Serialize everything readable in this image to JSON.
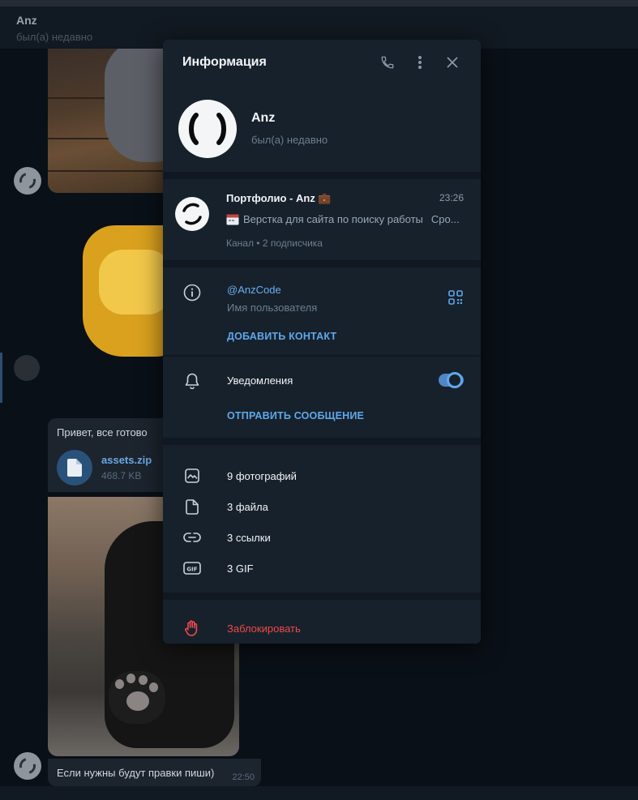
{
  "chat": {
    "title": "Anz",
    "status": "был(а) недавно",
    "messages": {
      "greeting": "Привет, все готово",
      "file_name": "assets.zip",
      "file_size": "468.7 KB",
      "last_text": "Если нужны будут правки пиши)",
      "last_time": "22:50"
    }
  },
  "info_panel": {
    "title": "Информация",
    "profile": {
      "name": "Anz",
      "status": "был(а) недавно"
    },
    "channel": {
      "name": "Портфолио - Anz 💼",
      "time": "23:26",
      "preview": "Верстка для сайта по поиску работы",
      "preview_tail": "Сро...",
      "subscribers": "Канал • 2 подписчика"
    },
    "username": {
      "value": "@AnzCode",
      "label": "Имя пользователя",
      "add_contact": "ДОБАВИТЬ КОНТАКТ"
    },
    "notifications": {
      "label": "Уведомления",
      "enabled": true,
      "send_message": "ОТПРАВИТЬ СООБЩЕНИЕ"
    },
    "media": [
      {
        "icon": "photo-icon",
        "label": "9 фотографий"
      },
      {
        "icon": "file-icon",
        "label": "3 файла"
      },
      {
        "icon": "link-icon",
        "label": "3 ссылки"
      },
      {
        "icon": "gif-icon",
        "label": "3 GIF"
      }
    ],
    "block": {
      "label": "Заблокировать"
    }
  },
  "colors": {
    "accent": "#5fa8ec",
    "danger": "#ee4a4a",
    "panel_bg": "#17212b"
  }
}
